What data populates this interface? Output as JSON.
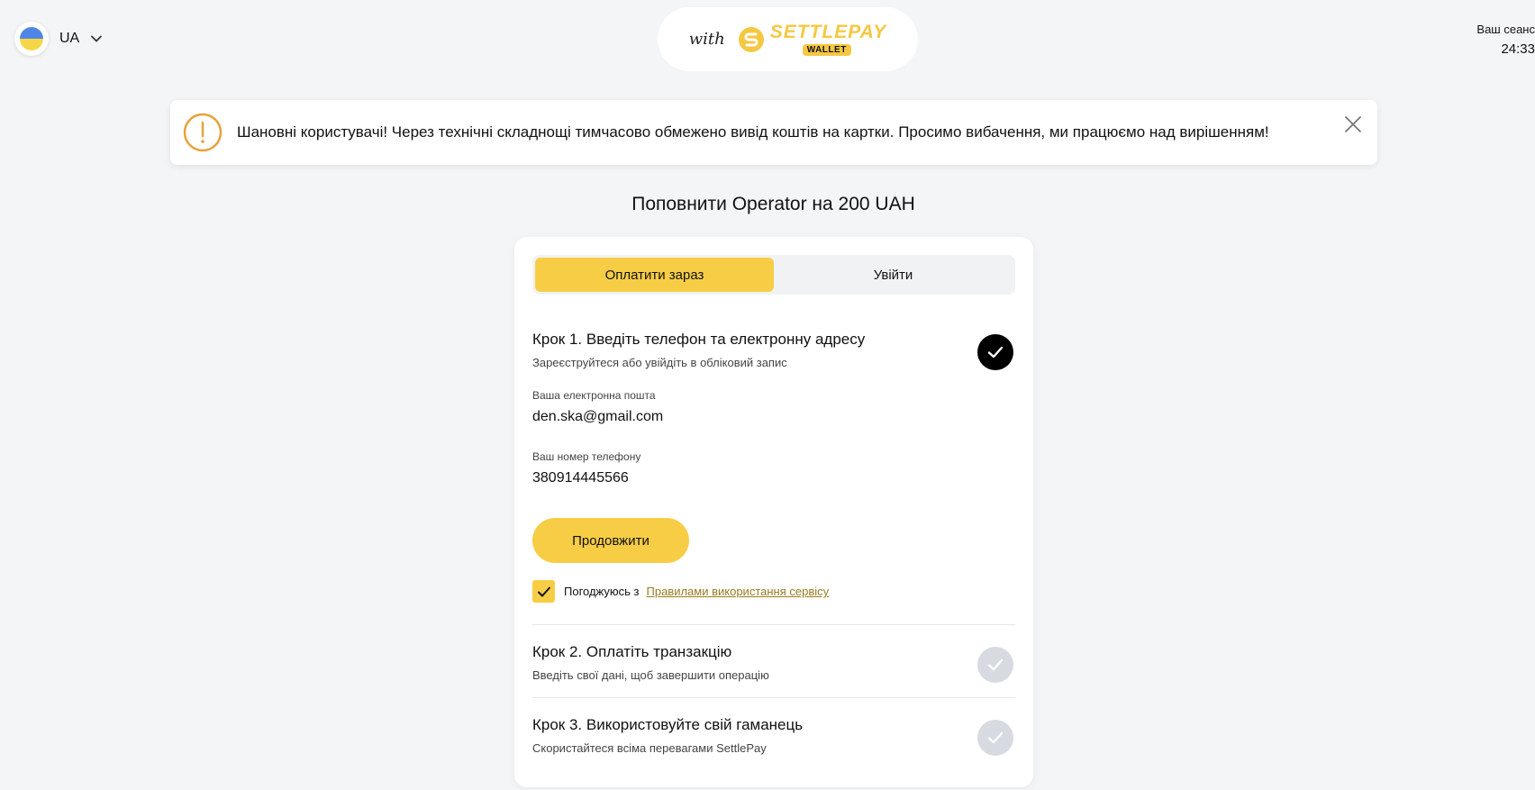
{
  "header": {
    "language": "UA",
    "brand_with": "with",
    "brand_name": "SETTLEPAY",
    "brand_badge": "WALLET",
    "session_label": "Ваш сеанс",
    "session_timer": "24:33"
  },
  "alert": {
    "message": "Шановні користувачі! Через технічні складнощі тимчасово обмежено вивід коштів на картки. Просимо вибачення, ми працюємо над вирішенням!"
  },
  "page": {
    "title": "Поповнити Operator на 200 UAH"
  },
  "tabs": [
    {
      "label": "Оплатити зараз",
      "active": true
    },
    {
      "label": "Увійти",
      "active": false
    }
  ],
  "steps": [
    {
      "title": "Крок 1. Введіть телефон та електронну адресу",
      "subtitle": "Зареєструйтеся або увійдіть в обліковий запис",
      "status": "done"
    },
    {
      "title": "Крок 2. Оплатіть транзакцію",
      "subtitle": "Введіть свої дані, щоб завершити операцію",
      "status": "pending"
    },
    {
      "title": "Крок 3. Використовуйте свій гаманець",
      "subtitle": "Скористайтеся всіма перевагами SettlePay",
      "status": "pending"
    }
  ],
  "form": {
    "email_label": "Ваша електронна пошта",
    "email_value": "den.ska@gmail.com",
    "phone_label": "Ваш номер телефону",
    "phone_value": "380914445566",
    "continue_label": "Продовжити",
    "agree_text": "Погоджуюсь з",
    "agree_link": "Правилами використання сервісу",
    "agree_checked": true
  },
  "colors": {
    "accent": "#f7cd45",
    "brand": "#f5c842",
    "alert_icon": "#e8a23c",
    "step_done": "#000000",
    "step_pending": "#d7dbe1"
  }
}
